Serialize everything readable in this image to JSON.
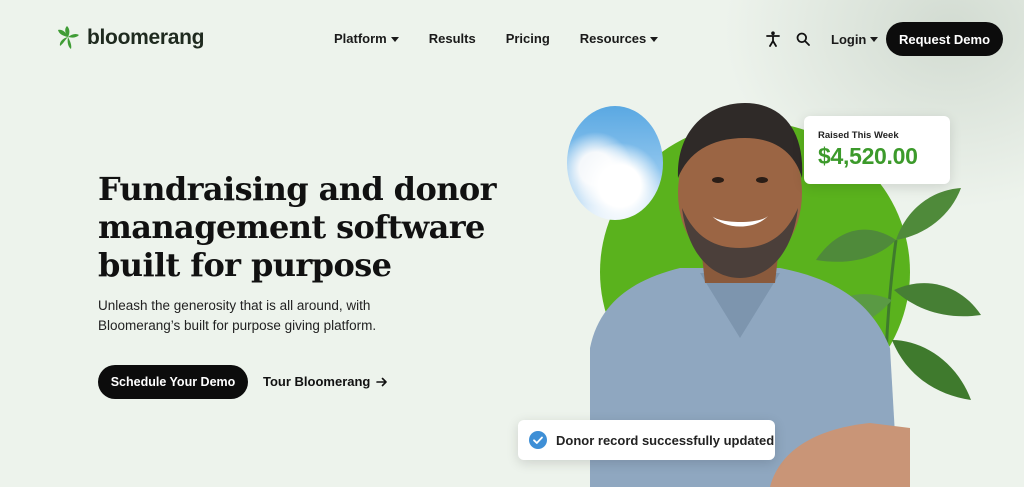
{
  "brand": {
    "name": "bloomerang",
    "logo_color": "#3f9c35"
  },
  "nav": {
    "items": [
      {
        "label": "Platform",
        "has_dropdown": true
      },
      {
        "label": "Results",
        "has_dropdown": false
      },
      {
        "label": "Pricing",
        "has_dropdown": false
      },
      {
        "label": "Resources",
        "has_dropdown": true
      }
    ],
    "accessibility_icon": "accessibility-icon",
    "search_icon": "search-icon",
    "login_label": "Login",
    "request_demo_label": "Request Demo"
  },
  "hero": {
    "title": "Fundraising and donor management software built for purpose",
    "subtitle": "Unleash the generosity that is all around, with Bloomerang’s built for purpose giving platform.",
    "primary_cta": "Schedule Your Demo",
    "secondary_cta": "Tour Bloomerang",
    "secondary_cta_icon": "arrow-right-icon"
  },
  "raised_card": {
    "label": "Raised This Week",
    "amount": "$4,520.00",
    "amount_color": "#3c9a2b"
  },
  "toast": {
    "text": "Donor record successfully updated",
    "icon": "check-circle-icon",
    "icon_color": "#3e8fd6"
  },
  "colors": {
    "background": "#edf3ec",
    "accent_green": "#5ab21d",
    "button_dark": "#0c0c0c"
  }
}
